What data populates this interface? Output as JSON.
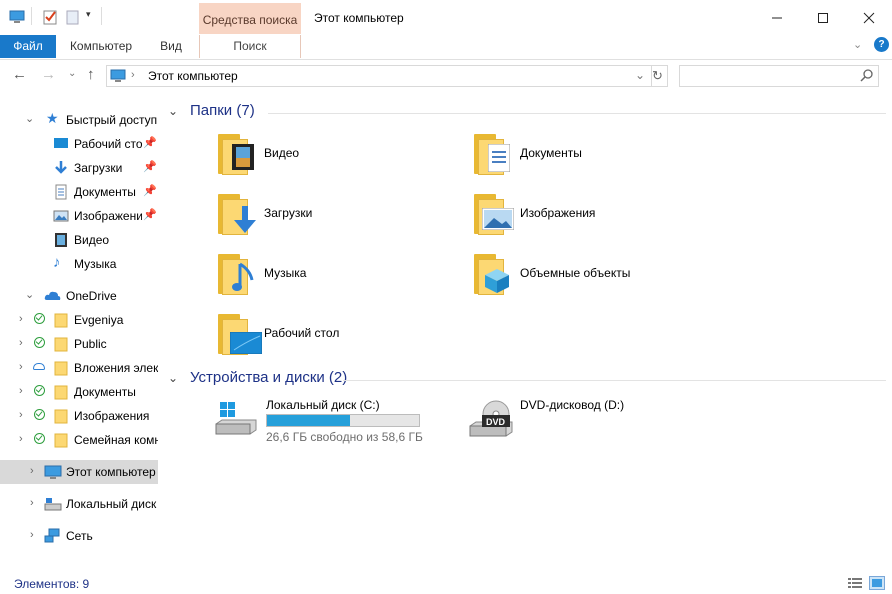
{
  "titlebar": {
    "context_tab": "Средства поиска",
    "window_title": "Этот компьютер"
  },
  "ribbon": {
    "tabs": [
      "Файл",
      "Компьютер",
      "Вид",
      "Поиск"
    ]
  },
  "address": {
    "path": "Этот компьютер",
    "search_placeholder": ""
  },
  "navpane": {
    "quick_access": "Быстрый доступ",
    "quick_items": [
      {
        "label": "Рабочий стол",
        "icon": "desktop-icon",
        "pinned": true
      },
      {
        "label": "Загрузки",
        "icon": "downloads-icon",
        "pinned": true
      },
      {
        "label": "Документы",
        "icon": "documents-icon",
        "pinned": true
      },
      {
        "label": "Изображения",
        "icon": "pictures-icon",
        "pinned": true
      },
      {
        "label": "Видео",
        "icon": "video-icon",
        "pinned": false
      },
      {
        "label": "Музыка",
        "icon": "music-icon",
        "pinned": false
      }
    ],
    "onedrive": "OneDrive",
    "onedrive_items": [
      {
        "label": "Evgeniya",
        "status": "synced"
      },
      {
        "label": "Public",
        "status": "synced"
      },
      {
        "label": "Вложения электронной почты",
        "status": "cloud"
      },
      {
        "label": "Документы",
        "status": "synced"
      },
      {
        "label": "Изображения",
        "status": "synced"
      },
      {
        "label": "Семейная комната",
        "status": "synced"
      }
    ],
    "this_pc": "Этот компьютер",
    "local_disk": "Локальный диск (C:)",
    "network": "Сеть"
  },
  "content": {
    "folders_header": "Папки (7)",
    "folders": [
      {
        "name": "Видео",
        "overlay": "film-icon"
      },
      {
        "name": "Документы",
        "overlay": "document-icon"
      },
      {
        "name": "Загрузки",
        "overlay": "download-arrow-icon"
      },
      {
        "name": "Изображения",
        "overlay": "picture-icon"
      },
      {
        "name": "Музыка",
        "overlay": "music-note-icon"
      },
      {
        "name": "Объемные объекты",
        "overlay": "cube-icon"
      },
      {
        "name": "Рабочий стол",
        "overlay": "desktop-icon"
      }
    ],
    "devices_header": "Устройства и диски (2)",
    "drives": [
      {
        "name": "Локальный диск (C:)",
        "free_text": "26,6 ГБ свободно из 58,6 ГБ",
        "used_fraction": 0.546
      },
      {
        "name": "DVD-дисковод (D:)",
        "badge": "DVD"
      }
    ]
  },
  "status": {
    "items_count": "Элементов: 9"
  },
  "colors": {
    "accent": "#1979ca",
    "context_tab": "#f8d5c4",
    "group_header": "#1e3287",
    "drive_bar": "#26a0da",
    "selection": "#d9d9d9"
  }
}
